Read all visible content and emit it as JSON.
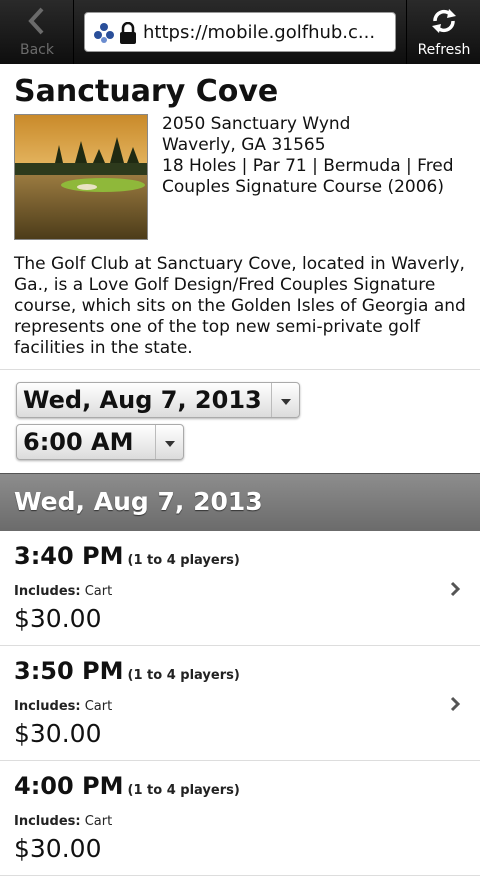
{
  "browser": {
    "back_label": "Back",
    "url": "https://mobile.golfhub.c...",
    "refresh_label": "Refresh"
  },
  "course": {
    "name": "Sanctuary Cove",
    "address_line1": "2050 Sanctuary Wynd",
    "address_line2": "Waverly, GA 31565",
    "details": "18 Holes | Par 71 | Bermuda | Fred Couples Signature Course (2006)",
    "description": "The Golf Club at Sanctuary Cove, located in Waverly, Ga., is a Love Golf Design/Fred Couples Signature course, which sits on the Golden Isles of Georgia and represents one of the top new semi-private golf facilities in the state."
  },
  "filters": {
    "date_value": "Wed, Aug 7, 2013",
    "time_value": "6:00 AM"
  },
  "section_header": "Wed, Aug 7, 2013",
  "tee_times": [
    {
      "time": "3:40 PM",
      "players": "(1 to 4 players)",
      "includes_label": "Includes:",
      "includes_value": "Cart",
      "price": "$30.00"
    },
    {
      "time": "3:50 PM",
      "players": "(1 to 4 players)",
      "includes_label": "Includes:",
      "includes_value": "Cart",
      "price": "$30.00"
    },
    {
      "time": "4:00 PM",
      "players": "(1 to 4 players)",
      "includes_label": "Includes:",
      "includes_value": "Cart",
      "price": "$30.00"
    }
  ]
}
